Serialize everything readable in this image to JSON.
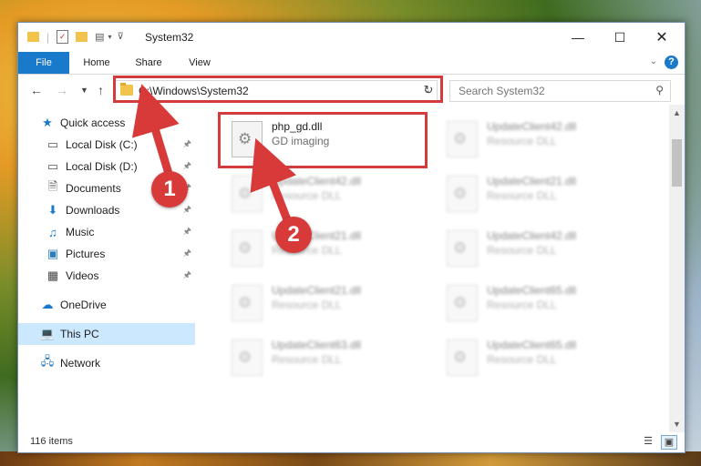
{
  "window": {
    "title": "System32"
  },
  "ribbon": {
    "tabs": [
      "File",
      "Home",
      "Share",
      "View"
    ]
  },
  "address": {
    "path": "C:\\Windows\\System32"
  },
  "search": {
    "placeholder": "Search System32"
  },
  "sidebar": {
    "items": [
      {
        "label": "Quick access",
        "icon": "star-icon"
      },
      {
        "label": "Local Disk (C:)",
        "icon": "drive-icon"
      },
      {
        "label": "Local Disk (D:)",
        "icon": "drive-icon"
      },
      {
        "label": "Documents",
        "icon": "document-icon"
      },
      {
        "label": "Downloads",
        "icon": "download-icon"
      },
      {
        "label": "Music",
        "icon": "music-icon"
      },
      {
        "label": "Pictures",
        "icon": "picture-icon"
      },
      {
        "label": "Videos",
        "icon": "video-icon"
      },
      {
        "label": "OneDrive",
        "icon": "cloud-icon"
      },
      {
        "label": "This PC",
        "icon": "computer-icon"
      },
      {
        "label": "Network",
        "icon": "network-icon"
      }
    ]
  },
  "files": [
    {
      "name": "php_gd.dll",
      "desc": "GD imaging"
    },
    {
      "name": "UpdateClient42.dll",
      "desc": "Resource DLL"
    },
    {
      "name": "UpdateClient42.dll",
      "desc": "Resource DLL"
    },
    {
      "name": "UpdateClient21.dll",
      "desc": "Resource DLL"
    },
    {
      "name": "UpdateClient21.dll",
      "desc": "Resource DLL"
    },
    {
      "name": "UpdateClient42.dll",
      "desc": "Resource DLL"
    },
    {
      "name": "UpdateClient21.dll",
      "desc": "Resource DLL"
    },
    {
      "name": "UpdateClient65.dll",
      "desc": "Resource DLL"
    },
    {
      "name": "UpdateClient63.dll",
      "desc": "Resource DLL"
    },
    {
      "name": "UpdateClient65.dll",
      "desc": "Resource DLL"
    }
  ],
  "status": {
    "items": "116 items"
  },
  "annotations": {
    "step1": "1",
    "step2": "2"
  },
  "colors": {
    "accent": "#1979ca",
    "highlight": "#d23c3c",
    "selected": "#cce8ff"
  }
}
